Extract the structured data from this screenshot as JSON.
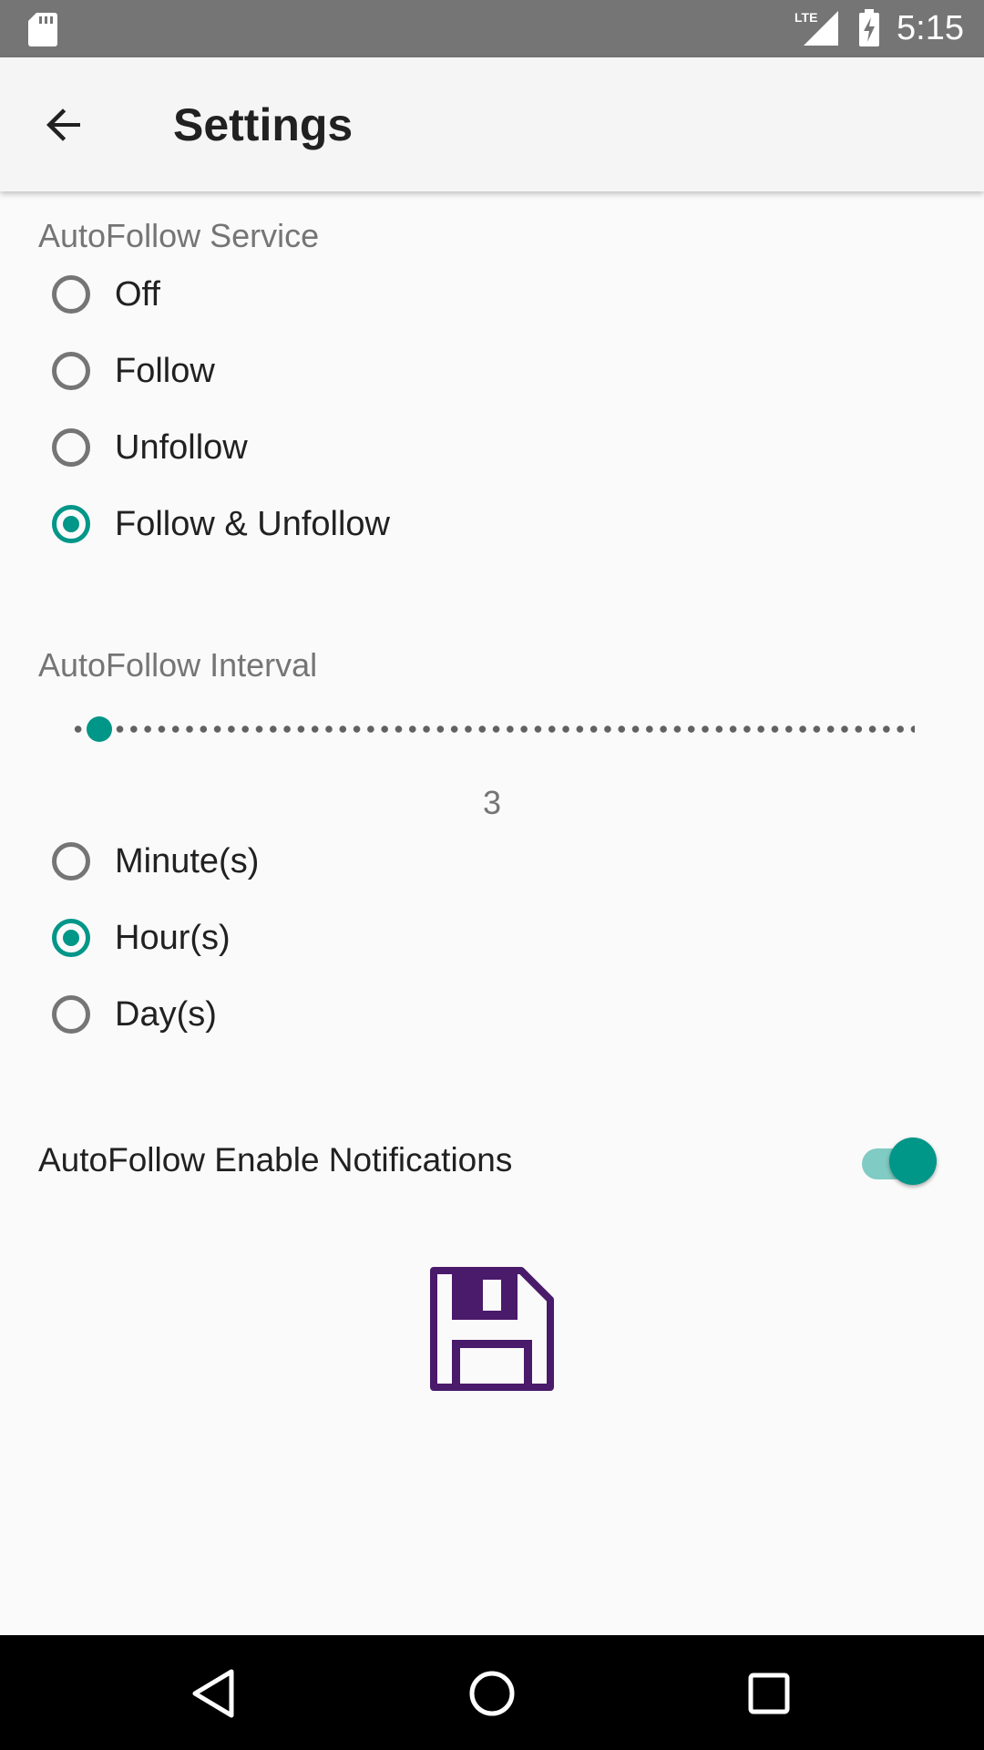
{
  "status_bar": {
    "time": "5:15",
    "network_label": "LTE",
    "icons": [
      "sd-card-icon",
      "lte-signal-icon",
      "battery-charging-icon"
    ]
  },
  "app_bar": {
    "title": "Settings",
    "back_icon": "arrow-back-icon"
  },
  "service": {
    "label": "AutoFollow Service",
    "options": [
      {
        "label": "Off",
        "checked": false
      },
      {
        "label": "Follow",
        "checked": false
      },
      {
        "label": "Unfollow",
        "checked": false
      },
      {
        "label": "Follow & Unfollow",
        "checked": true
      }
    ]
  },
  "interval": {
    "label": "AutoFollow Interval",
    "slider_value": 3,
    "slider_value_text": "3",
    "unit_options": [
      {
        "label": "Minute(s)",
        "checked": false
      },
      {
        "label": "Hour(s)",
        "checked": true
      },
      {
        "label": "Day(s)",
        "checked": false
      }
    ]
  },
  "notifications": {
    "label": "AutoFollow Enable Notifications",
    "enabled": true
  },
  "save": {
    "icon": "floppy-disk-save-icon"
  },
  "nav_bar": {
    "icons": [
      "nav-back-icon",
      "nav-home-icon",
      "nav-recents-icon"
    ]
  },
  "colors": {
    "accent": "#009688",
    "accent_light": "#80cbc4",
    "save_icon": "#4a1a6b",
    "status_bar": "#757575",
    "app_bar": "#f5f5f5"
  }
}
